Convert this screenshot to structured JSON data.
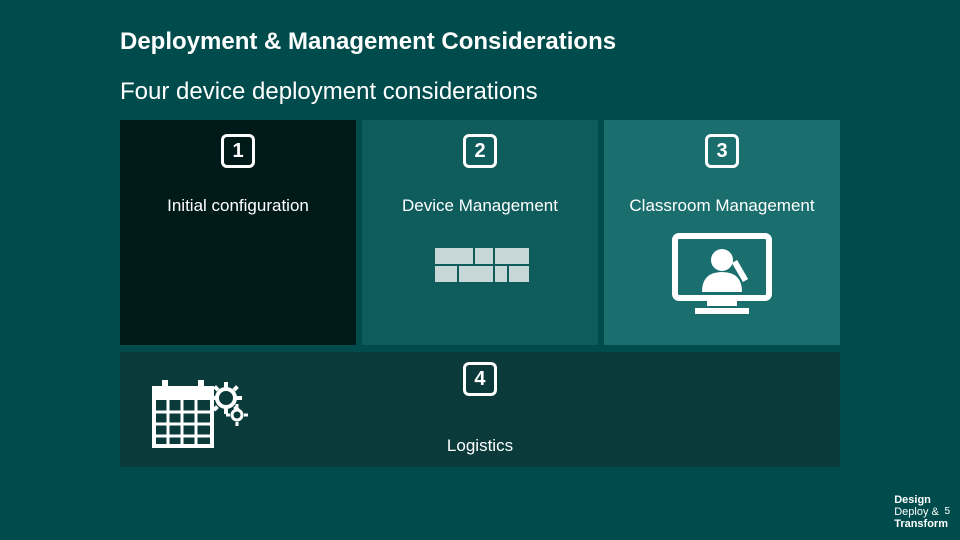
{
  "title": "Deployment & Management Considerations",
  "subtitle": "Four device deployment considerations",
  "tiles": [
    {
      "num": "1",
      "label": "Initial configuration"
    },
    {
      "num": "2",
      "label": "Device Management"
    },
    {
      "num": "3",
      "label": "Classroom Management"
    }
  ],
  "bottom": {
    "num": "4",
    "label": "Logistics"
  },
  "footer": {
    "line1": "Design",
    "line2": "Deploy &",
    "line3": "Transform",
    "page": "5"
  }
}
